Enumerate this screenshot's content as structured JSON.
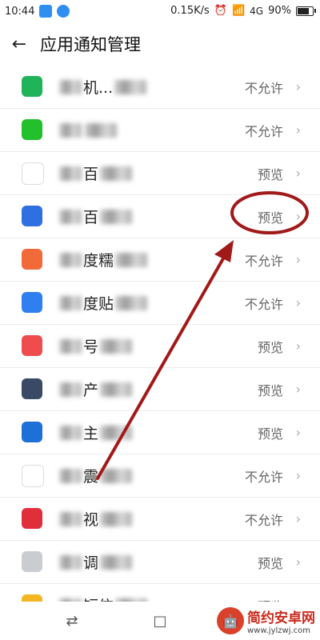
{
  "status_bar": {
    "time": "10:44",
    "speed": "0.15K/s",
    "network": "4G",
    "battery": "90%",
    "battery_level": 0.9
  },
  "header": {
    "title": "应用通知管理"
  },
  "apps": [
    {
      "name_visible": "机...",
      "status": "不允许",
      "icon": "green-plus-icon",
      "color": "#1fb45a"
    },
    {
      "name_visible": "",
      "status": "不允许",
      "icon": "iqiyi-icon",
      "color": "#22c02a"
    },
    {
      "name_visible": "百",
      "status": "预览",
      "icon": "baidu-paw-icon",
      "color": "#ffffff"
    },
    {
      "name_visible": "百",
      "status": "预览",
      "icon": "baidu-map-icon",
      "color": "#2f6fe0"
    },
    {
      "name_visible": "度糯",
      "status": "不允许",
      "icon": "nuomi-icon",
      "color": "#f26a3a"
    },
    {
      "name_visible": "度贴",
      "status": "不允许",
      "icon": "tieba-icon",
      "color": "#2f7ff0"
    },
    {
      "name_visible": "号",
      "status": "预览",
      "icon": "contact-icon",
      "color": "#ef4d4d"
    },
    {
      "name_visible": "产",
      "status": "预览",
      "icon": "circle-app-icon",
      "color": "#3a4a66"
    },
    {
      "name_visible": "主",
      "status": "预览",
      "icon": "steering-wheel-icon",
      "color": "#1f6fd8"
    },
    {
      "name_visible": "震",
      "status": "不允许",
      "icon": "seismograph-icon",
      "color": "#ffffff"
    },
    {
      "name_visible": "视",
      "status": "不允许",
      "icon": "tv-icon",
      "color": "#e02e3a"
    },
    {
      "name_visible": "调",
      "status": "预览",
      "icon": "grey-app-icon",
      "color": "#c9cdd2"
    },
    {
      "name_visible": "短信",
      "status": "预览",
      "icon": "sms-icon",
      "color": "#f3b623"
    }
  ],
  "navbar": {
    "back": "⇄",
    "home": "□"
  },
  "watermark": {
    "title": "简约安卓网",
    "url": "www.jylzwj.com"
  }
}
